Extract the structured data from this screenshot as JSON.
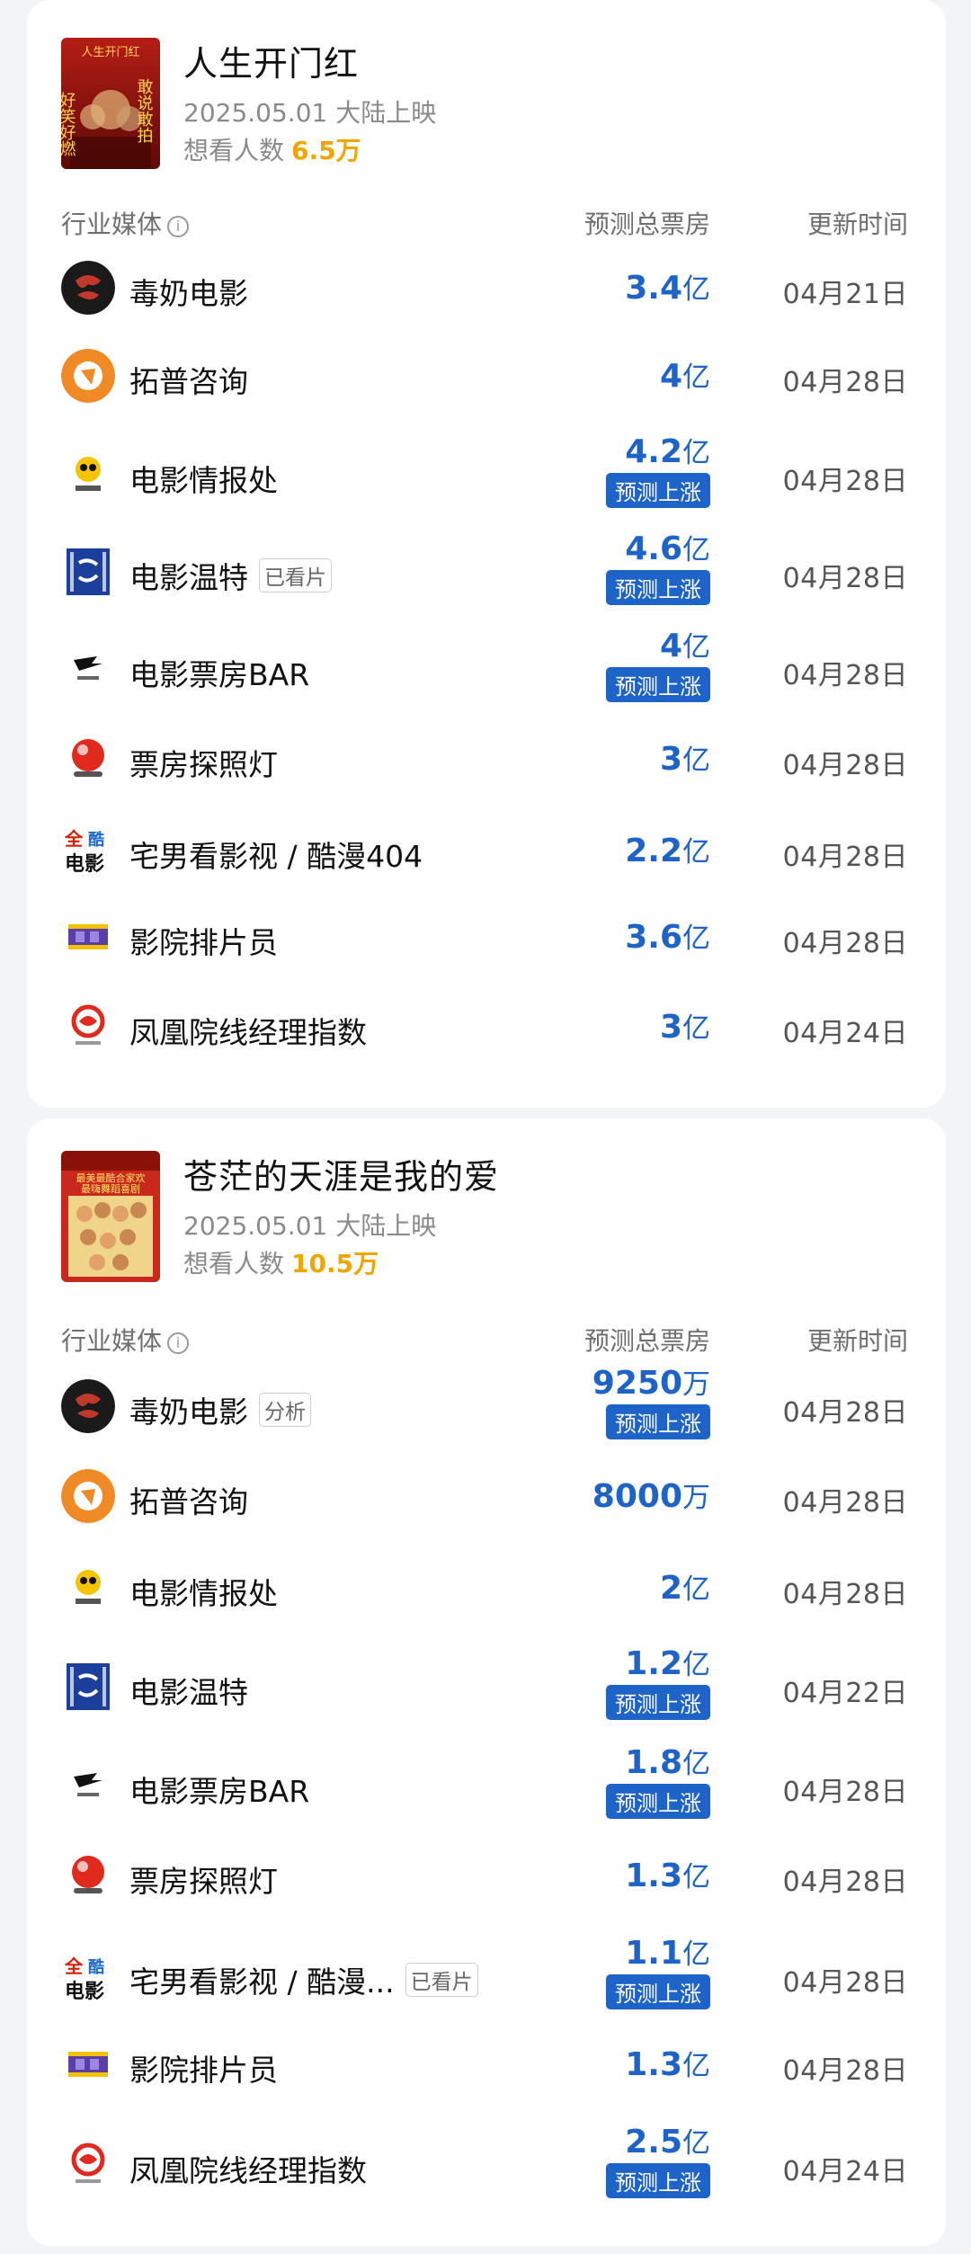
{
  "col_headers": {
    "media": "行业媒体",
    "info_icon": "ⓘ",
    "predicted": "预测总票房",
    "updated": "更新时间"
  },
  "rise_label": "预测上涨",
  "movies": [
    {
      "title": "人生开门红",
      "release": "2025.05.01 大陆上映",
      "want_label": "想看人数",
      "want_count": "6.5万",
      "poster": {
        "top_text": "人生开门红",
        "left_text": "好笑好燃",
        "right_text": "敢说敢拍"
      },
      "rows": [
        {
          "media": "毒奶电影",
          "tag": "",
          "value": "3.4",
          "unit": "亿",
          "date": "04月21日",
          "rise": false
        },
        {
          "media": "拓普咨询",
          "tag": "",
          "value": "4",
          "unit": "亿",
          "date": "04月28日",
          "rise": false
        },
        {
          "media": "电影情报处",
          "tag": "",
          "value": "4.2",
          "unit": "亿",
          "date": "04月28日",
          "rise": true
        },
        {
          "media": "电影温特",
          "tag": "已看片",
          "value": "4.6",
          "unit": "亿",
          "date": "04月28日",
          "rise": true
        },
        {
          "media": "电影票房BAR",
          "tag": "",
          "value": "4",
          "unit": "亿",
          "date": "04月28日",
          "rise": true
        },
        {
          "media": "票房探照灯",
          "tag": "",
          "value": "3",
          "unit": "亿",
          "date": "04月28日",
          "rise": false
        },
        {
          "media": "宅男看影视 / 酷漫404",
          "tag": "",
          "value": "2.2",
          "unit": "亿",
          "date": "04月28日",
          "rise": false
        },
        {
          "media": "影院排片员",
          "tag": "",
          "value": "3.6",
          "unit": "亿",
          "date": "04月28日",
          "rise": false
        },
        {
          "media": "凤凰院线经理指数",
          "tag": "",
          "value": "3",
          "unit": "亿",
          "date": "04月24日",
          "rise": false
        }
      ]
    },
    {
      "title": "苍茫的天涯是我的爱",
      "release": "2025.05.01 大陆上映",
      "want_label": "想看人数",
      "want_count": "10.5万",
      "poster": {
        "top_text": "最美最酷合家欢",
        "left_text": "最嗨舞蹈喜剧",
        "right_text": ""
      },
      "rows": [
        {
          "media": "毒奶电影",
          "tag": "分析",
          "value": "9250",
          "unit": "万",
          "date": "04月28日",
          "rise": true
        },
        {
          "media": "拓普咨询",
          "tag": "",
          "value": "8000",
          "unit": "万",
          "date": "04月28日",
          "rise": false
        },
        {
          "media": "电影情报处",
          "tag": "",
          "value": "2",
          "unit": "亿",
          "date": "04月28日",
          "rise": false
        },
        {
          "media": "电影温特",
          "tag": "",
          "value": "1.2",
          "unit": "亿",
          "date": "04月22日",
          "rise": true
        },
        {
          "media": "电影票房BAR",
          "tag": "",
          "value": "1.8",
          "unit": "亿",
          "date": "04月28日",
          "rise": true
        },
        {
          "media": "票房探照灯",
          "tag": "",
          "value": "1.3",
          "unit": "亿",
          "date": "04月28日",
          "rise": false
        },
        {
          "media": "宅男看影视 / 酷漫...",
          "tag": "已看片",
          "value": "1.1",
          "unit": "亿",
          "date": "04月28日",
          "rise": true
        },
        {
          "media": "影院排片员",
          "tag": "",
          "value": "1.3",
          "unit": "亿",
          "date": "04月28日",
          "rise": false
        },
        {
          "media": "凤凰院线经理指数",
          "tag": "",
          "value": "2.5",
          "unit": "亿",
          "date": "04月24日",
          "rise": true
        }
      ]
    }
  ]
}
